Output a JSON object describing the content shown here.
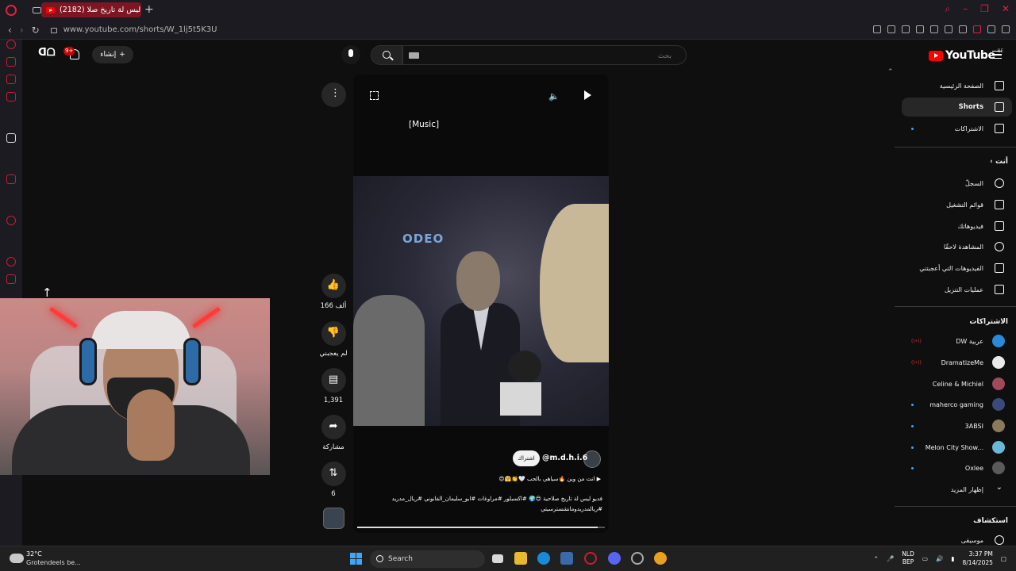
{
  "browser": {
    "tab_title": "(2182) فديو ليس لة تاريخ صلا",
    "url": "www.youtube.com/shorts/W_1lj5t5K3U"
  },
  "youtube": {
    "logo_text": "YouTube",
    "logo_country": "BE",
    "search_placeholder": "بحث",
    "create_label": "إنشاء",
    "notifications_badge": "9+"
  },
  "player": {
    "caption": "[Music]",
    "channel_handle": "@m.d.h.i.6",
    "subscribe_label": "اشتراك",
    "song_line": "انت من وين 🔥سياهي بالحب 🤍👏🤗😍",
    "description": "فديو ليس لة تاريخ صلاحية 😍🌍 #اكسبلور #مراوغات #ابو_سليمان_الفانوني #ريال_مدريد #ريالمدريدومانشسترسيتي",
    "progress": 0.97
  },
  "actions": {
    "like_count": "166 ألف",
    "dislike_label": "لم يعجبني",
    "comment_count": "1,391",
    "share_label": "مشاركة",
    "remix_count": "6"
  },
  "guide": {
    "main": [
      {
        "label": "الصفحة الرئيسية",
        "icon": "home-icon"
      },
      {
        "label": "Shorts",
        "icon": "shorts-icon",
        "active": true
      },
      {
        "label": "الاشتراكات",
        "icon": "subscriptions-icon"
      }
    ],
    "you_header": "أنت",
    "you": [
      {
        "label": "السجلّ",
        "icon": "history-icon"
      },
      {
        "label": "قوائم التشغيل",
        "icon": "playlists-icon"
      },
      {
        "label": "فيديوهاتك",
        "icon": "your-videos-icon"
      },
      {
        "label": "المشاهدة لاحقًا",
        "icon": "watch-later-icon"
      },
      {
        "label": "الفيديوهات التي أعجبتني",
        "icon": "liked-videos-icon"
      },
      {
        "label": "عمليات التنزيل",
        "icon": "downloads-icon"
      }
    ],
    "subs_header": "الاشتراكات",
    "subs": [
      {
        "label": "DW عربية"
      },
      {
        "label": "DramatizeMe"
      },
      {
        "label": "Celine & Michiel"
      },
      {
        "label": "maherco gaming"
      },
      {
        "label": "3ABSI"
      },
      {
        "label": "Melon City Show..."
      },
      {
        "label": "Oxlee"
      }
    ],
    "show_more_label": "إظهار المزيد",
    "explore_header": "استكشاف",
    "explore": [
      {
        "label": "موسيقى",
        "icon": "music-icon"
      }
    ]
  },
  "taskbar": {
    "temperature": "32°C",
    "weather_text": "Grotendeels be...",
    "search_label": "Search",
    "lang_1": "NLD",
    "lang_2": "BEP",
    "time": "3:37 PM",
    "date": "8/14/2025"
  }
}
